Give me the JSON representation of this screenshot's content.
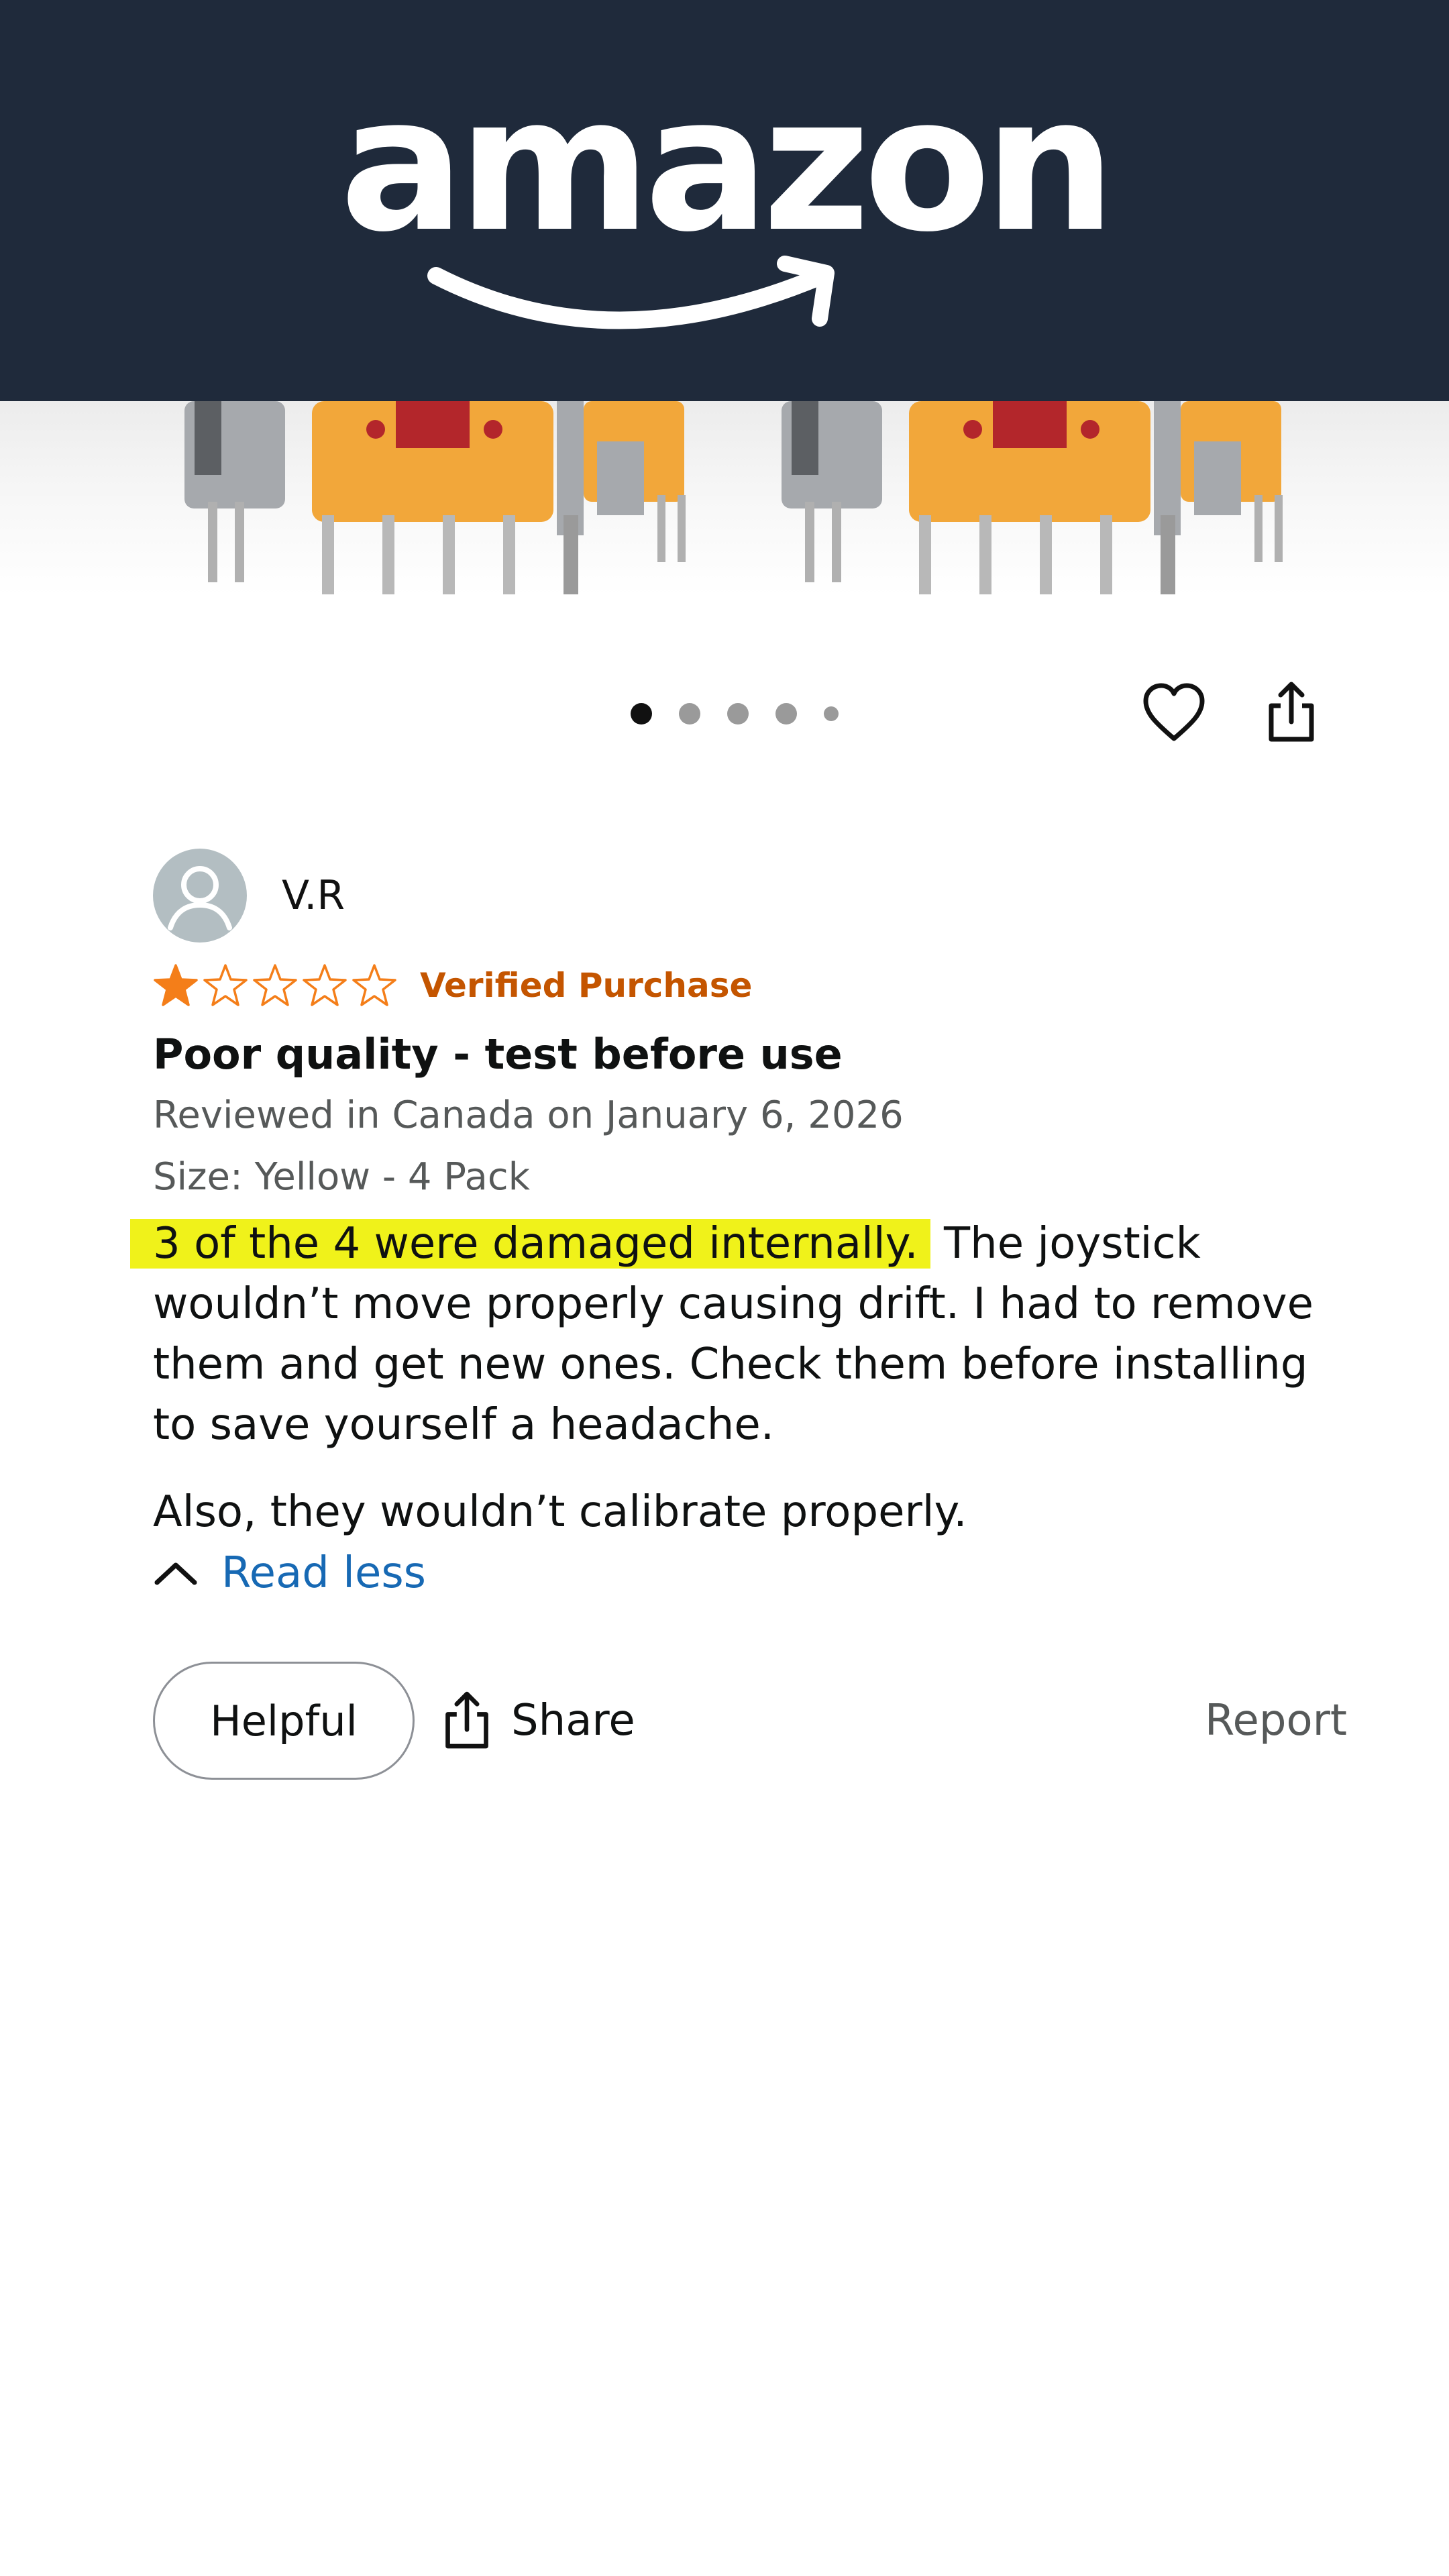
{
  "header": {
    "logo_text": "amazon"
  },
  "carousel": {
    "image_count": 5,
    "active_index": 0,
    "icons": [
      "heart-icon",
      "share-icon"
    ]
  },
  "review": {
    "reviewer_name": "V.R",
    "rating": 1,
    "rating_max": 5,
    "verified_label": "Verified Purchase",
    "title": "Poor quality - test before use",
    "reviewed_in": "Reviewed in Canada on January 6, 2026",
    "size": "Size: Yellow - 4 Pack",
    "body_highlighted": "3 of the 4 were damaged internally.",
    "body_rest": " The joystick wouldn’t move properly causing drift. I had to remove them and get new ones. Check them before installing to save yourself a headache.",
    "body_paragraph_2": "Also, they wouldn’t calibrate properly.",
    "read_less_label": "Read less"
  },
  "actions": {
    "helpful_label": "Helpful",
    "share_label": "Share",
    "report_label": "Report"
  },
  "colors": {
    "header_bg": "#1f2a3b",
    "star_fill": "#f47e19",
    "verified": "#c45500",
    "link": "#1769b4",
    "highlight": "#f0f21a"
  }
}
